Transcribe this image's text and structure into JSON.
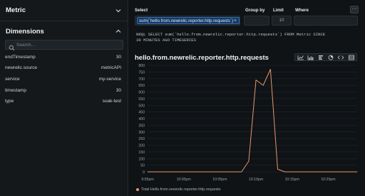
{
  "sidebar": {
    "metric_title": "Metric",
    "dimensions_title": "Dimensions",
    "search_placeholder": "Search...",
    "dimensions": [
      {
        "key": "endTimestamp",
        "value": "30"
      },
      {
        "key": "newrelic.source",
        "value": "metricAPI"
      },
      {
        "key": "service",
        "value": "my-service"
      },
      {
        "key": "timestamp",
        "value": "30"
      },
      {
        "key": "type",
        "value": "soak-test"
      }
    ]
  },
  "query": {
    "select_label": "Select",
    "select_value": "sum(`hello.from.newrelic.reporter.http.requests`)",
    "group_by_label": "Group by",
    "limit_label": "Limit",
    "limit_value": "10",
    "where_label": "Where",
    "more_label": "···",
    "nrql_line1": "NRQL SELECT sum(`hello.from.newrelic.reporter.http.requests`) FROM Metric SINCE",
    "nrql_line2": "30 MINUTES AGO TIMESERIES"
  },
  "chart_title": "hello.from.newrelic.reporter.http.requests",
  "toolbar_icons": [
    "line-chart-icon",
    "bar-chart-icon",
    "billboard-icon",
    "pie-chart-icon",
    "code-icon",
    "table-icon"
  ],
  "chart_data": {
    "type": "line",
    "x": [
      "9:55pm",
      "9:56pm",
      "9:57pm",
      "9:58pm",
      "9:59pm",
      "10:00pm",
      "10:01pm",
      "10:02pm",
      "10:03pm",
      "10:04pm",
      "10:05pm",
      "10:06pm",
      "10:07pm",
      "10:08pm",
      "10:09pm",
      "10:10pm",
      "10:11pm",
      "10:12pm",
      "10:13pm",
      "10:14pm",
      "10:15pm",
      "10:16pm",
      "10:17pm",
      "10:18pm",
      "10:19pm",
      "10:20pm",
      "10:21pm",
      "10:22pm",
      "10:23pm",
      "10:24pm"
    ],
    "series": [
      {
        "name": "Total Hello.from.newrelic.reporter.http.requests",
        "values": [
          0,
          0,
          0,
          0,
          0,
          0,
          0,
          0,
          0,
          0,
          0,
          0,
          0,
          0,
          80,
          690,
          650,
          770,
          20,
          0,
          0,
          0,
          0,
          0,
          0,
          0,
          0,
          0,
          0,
          0
        ]
      }
    ],
    "yticks": [
      "0",
      "50",
      "100",
      "150",
      "200",
      "250",
      "300",
      "350",
      "400",
      "450",
      "500",
      "550",
      "600",
      "650",
      "700",
      "750",
      "800"
    ],
    "xticks": [
      "9:55pm",
      "10:00pm",
      "10:05pm",
      "10:10pm",
      "10:15pm",
      "10:20pm"
    ],
    "ylim": [
      0,
      800
    ],
    "grid": true,
    "line_color": "#e8956c"
  }
}
